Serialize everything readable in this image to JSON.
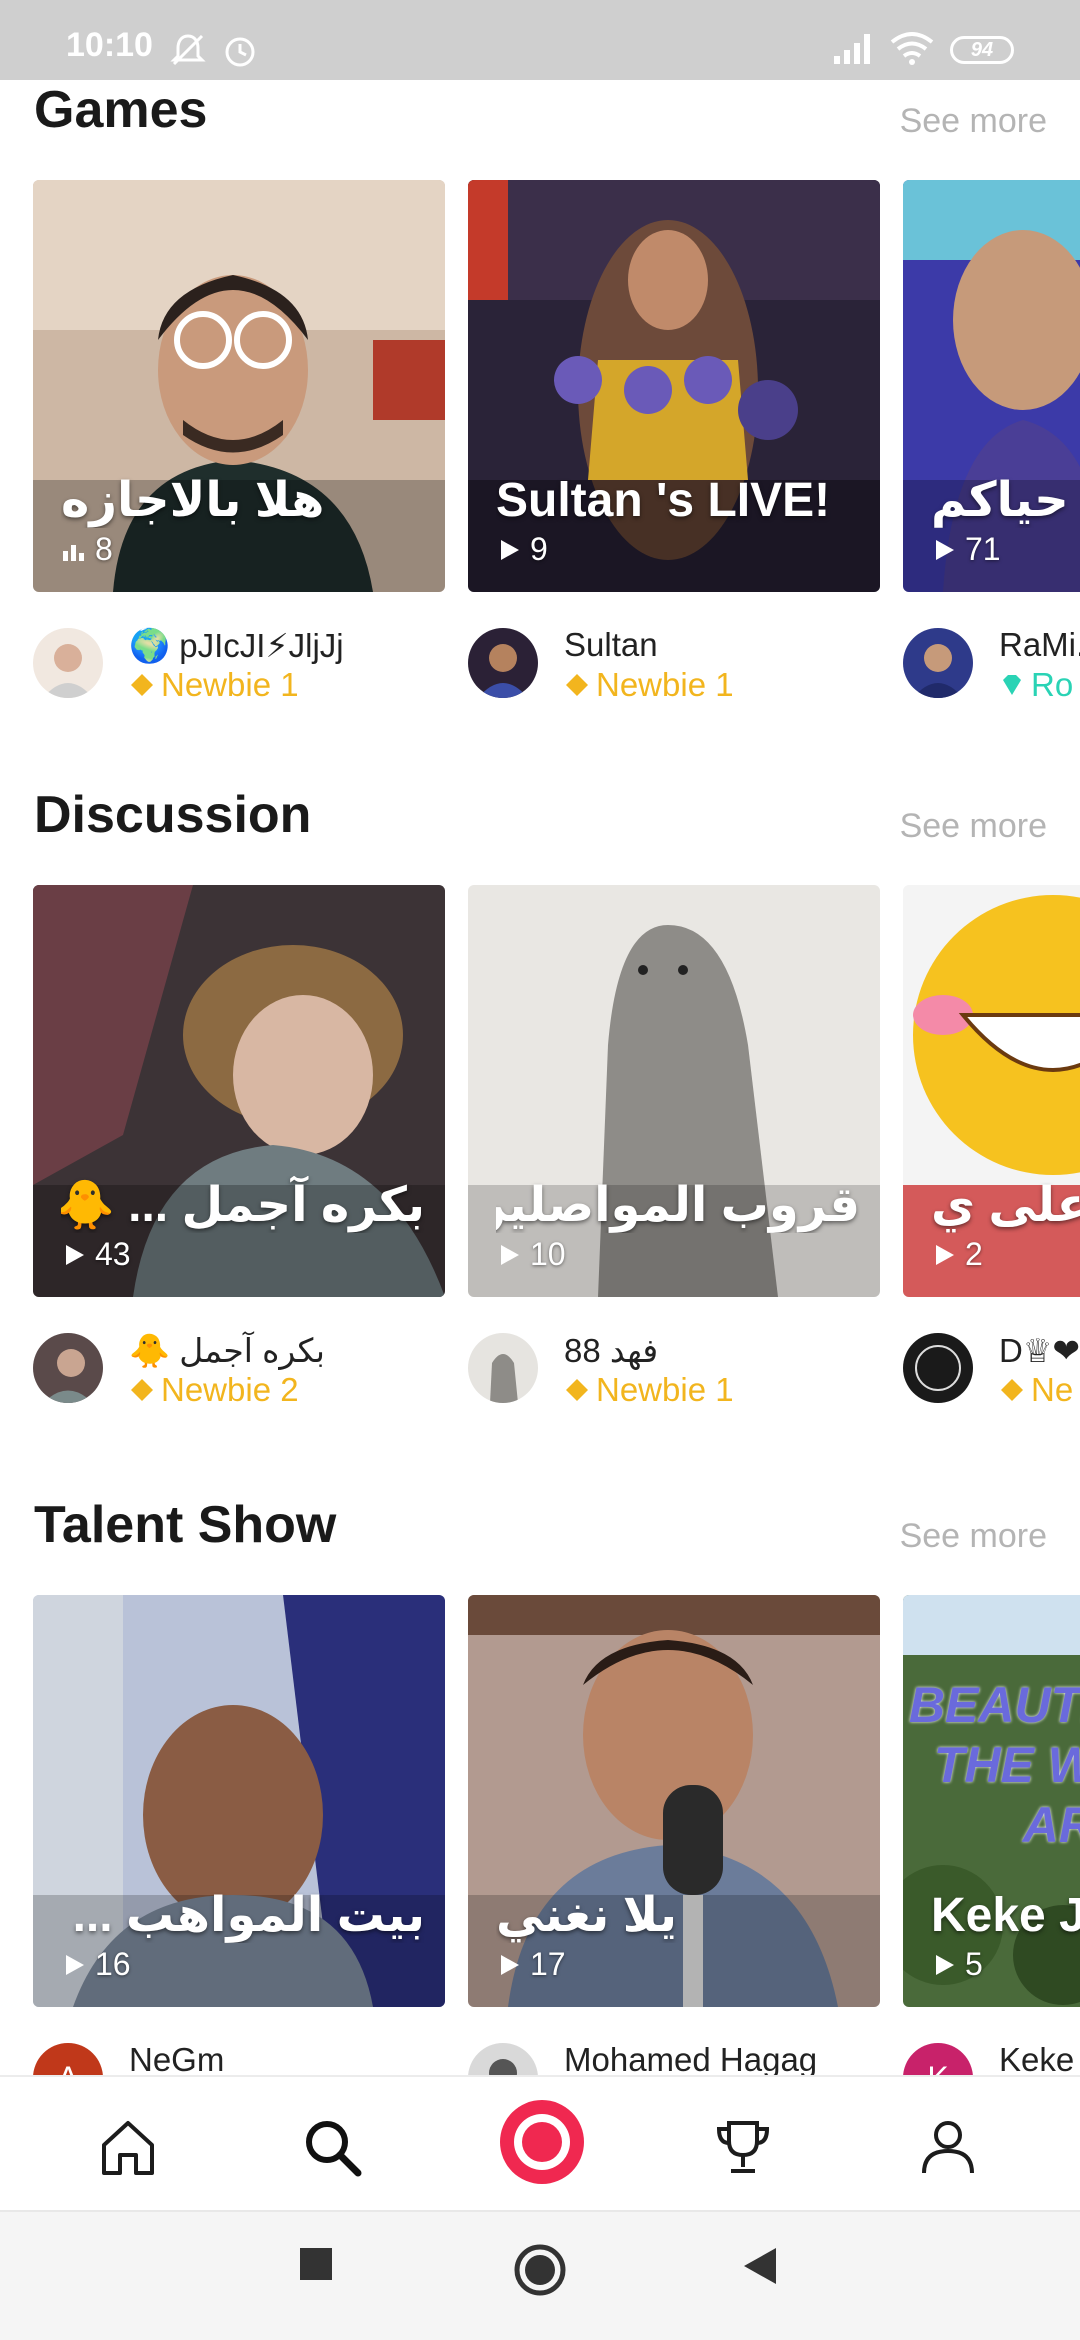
{
  "status_bar": {
    "time": "10:10",
    "battery": "94"
  },
  "sections": [
    {
      "title": "Games",
      "see_more": "See more",
      "cards": [
        {
          "title": "هلا بالاجازه",
          "count": "8",
          "owner_name": "🌍 pJIcJI⚡JljJj",
          "owner_level": "Newbie 1"
        },
        {
          "title": "Sultan 's LIVE!",
          "count": "9",
          "owner_name": "Sultan",
          "owner_level": "Newbie 1"
        },
        {
          "title": "حياكم",
          "count": "71",
          "owner_name": "RaMi..",
          "owner_level": "Ro"
        }
      ]
    },
    {
      "title": "Discussion",
      "see_more": "See more",
      "cards": [
        {
          "title": "بكره آجمل ... 🐥 !",
          "count": "43",
          "owner_name": "🐥 بكره آجمل",
          "owner_level": "Newbie 2"
        },
        {
          "title": "قروب المواصلين",
          "count": "10",
          "owner_name": "فهد 88",
          "owner_level": "Newbie 1"
        },
        {
          "title": "على ي...",
          "count": "2",
          "owner_name": "D♕❤",
          "owner_level": "Ne"
        }
      ]
    },
    {
      "title": "Talent Show",
      "see_more": "See more",
      "cards": [
        {
          "title": "بيت المواهب ... ✨",
          "count": "16",
          "owner_name": "NeGm",
          "owner_level": ""
        },
        {
          "title": "يلا نغني",
          "count": "17",
          "owner_name": "Mohamed Hagag",
          "owner_level": ""
        },
        {
          "title": "Keke J",
          "count": "5",
          "owner_name": "Keke",
          "owner_level": "",
          "overlay_text": "BEAUTI THE W AR"
        }
      ]
    }
  ],
  "bottom_nav": [
    "home",
    "search",
    "live",
    "trophy",
    "profile"
  ],
  "colors": {
    "accent": "#f02850",
    "level": "#f2b51e",
    "level_diamond": "#2ad3b5"
  }
}
